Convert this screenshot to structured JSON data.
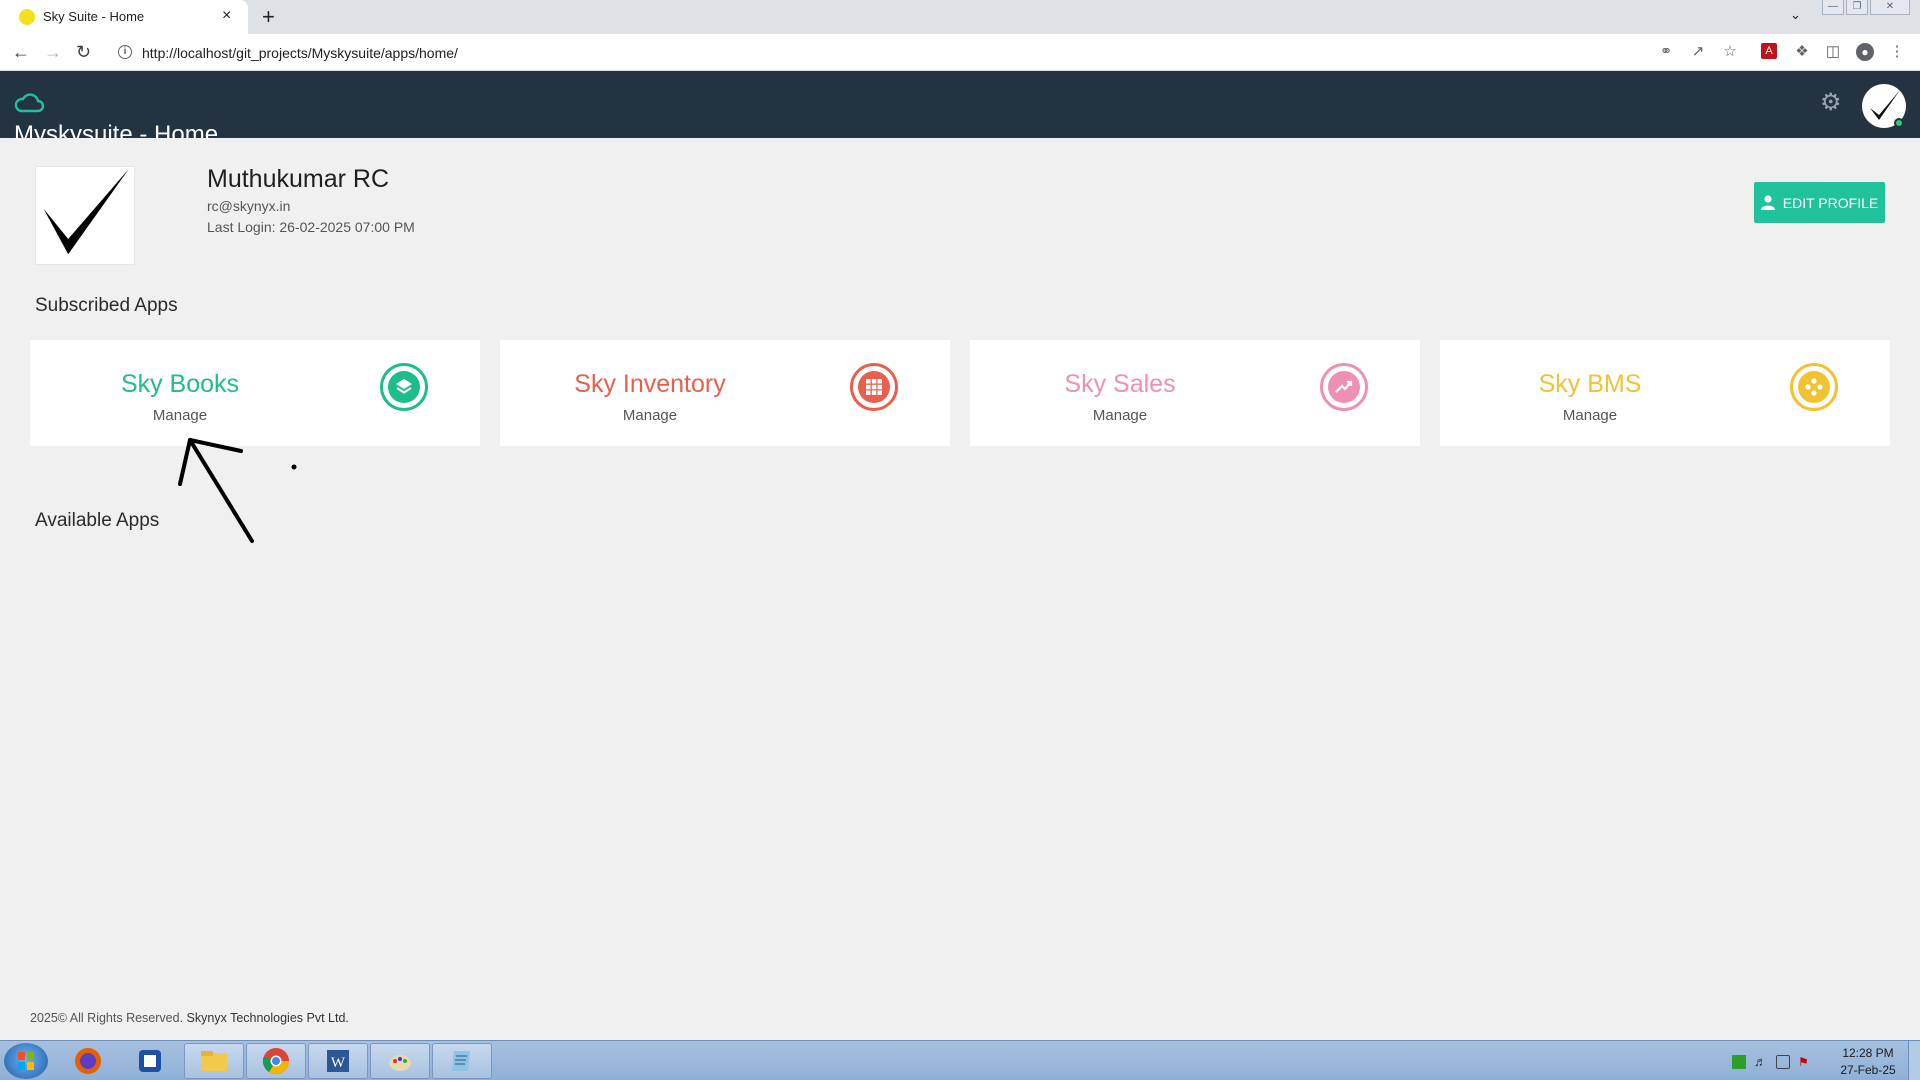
{
  "browser": {
    "tab_title": "Sky Suite - Home",
    "tab_close": "×",
    "new_tab": "+",
    "url": "http://localhost/git_projects/Myskysuite/apps/home/"
  },
  "header": {
    "title": "Myskysuite - Home"
  },
  "profile": {
    "name": "Muthukumar RC",
    "email": "rc@skynyx.in",
    "last_login": "Last Login: 26-02-2025 07:00 PM",
    "edit_label": "EDIT PROFILE"
  },
  "sections": {
    "subscribed": "Subscribed Apps",
    "available": "Available Apps"
  },
  "apps": [
    {
      "name": "Sky Books",
      "action": "Manage",
      "color": "#1fbc8c",
      "icon": "layers-icon"
    },
    {
      "name": "Sky Inventory",
      "action": "Manage",
      "color": "#e8604c",
      "icon": "grid-icon"
    },
    {
      "name": "Sky Sales",
      "action": "Manage",
      "color": "#ef8fb5",
      "icon": "trending-up-icon"
    },
    {
      "name": "Sky BMS",
      "action": "Manage",
      "color": "#f1c232",
      "icon": "gamepad-icon"
    }
  ],
  "footer": {
    "copyright": "2025© All Rights Reserved.",
    "company": "Skynyx Technologies Pvt Ltd."
  },
  "taskbar": {
    "time": "12:28 PM",
    "date": "27-Feb-25"
  }
}
